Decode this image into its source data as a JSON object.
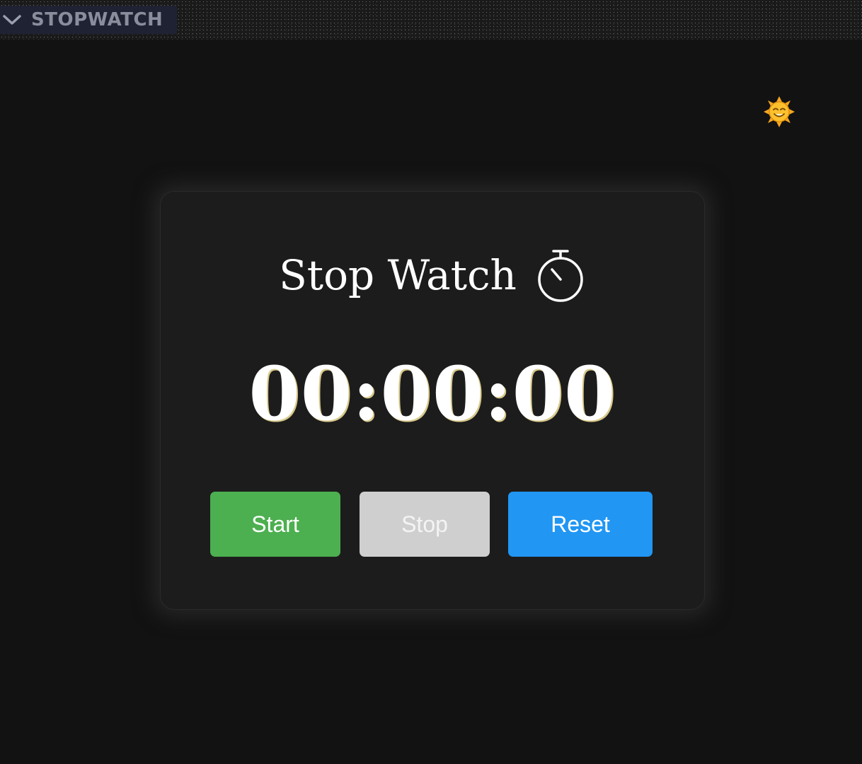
{
  "explorer": {
    "title": "STOPWATCH",
    "chevron_icon": "chevron-down-icon"
  },
  "theme_toggle": {
    "icon": "sun-icon",
    "color": "#f5a623"
  },
  "card": {
    "title": "Stop Watch",
    "title_icon": "stopwatch-icon",
    "time": "00:00:00"
  },
  "buttons": {
    "start": {
      "label": "Start",
      "color": "#4caf50"
    },
    "stop": {
      "label": "Stop",
      "color": "#cfcfcf"
    },
    "reset": {
      "label": "Reset",
      "color": "#2196f3"
    }
  }
}
